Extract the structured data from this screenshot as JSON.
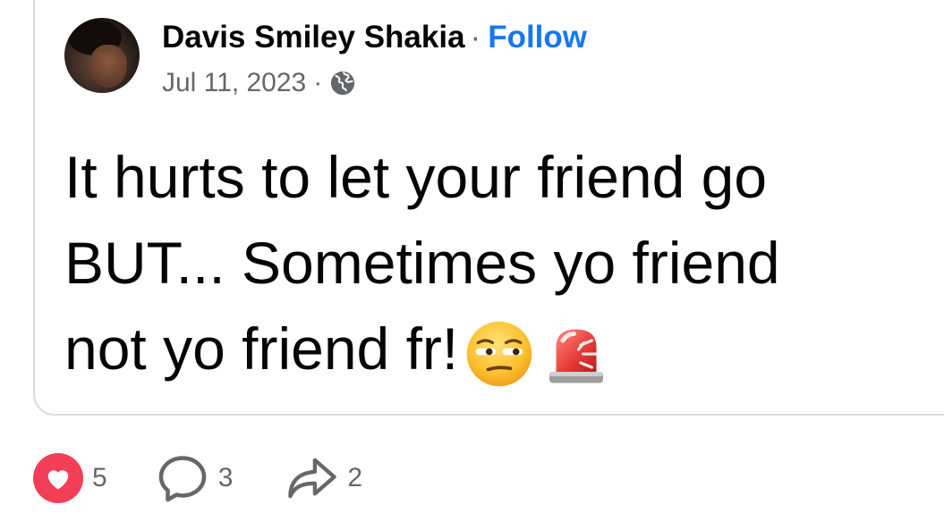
{
  "post": {
    "author": "Davis Smiley Shakia",
    "separator": "·",
    "follow_label": "Follow",
    "date": "Jul 11, 2023",
    "meta_separator": "·",
    "visibility_icon": "globe-icon",
    "text_lines": [
      "It hurts to let your friend go",
      "BUT... Sometimes yo friend",
      "not yo friend fr!"
    ],
    "emojis": [
      "unamused-face-emoji",
      "police-light-emoji"
    ]
  },
  "actions": {
    "likes": "5",
    "comments": "3",
    "shares": "2",
    "like_icon": "heart-icon",
    "comment_icon": "comment-icon",
    "share_icon": "share-icon"
  },
  "colors": {
    "follow": "#1877f2",
    "secondary_text": "#65676b",
    "like_bubble": "#f33e58",
    "card_border": "#dadde1"
  }
}
